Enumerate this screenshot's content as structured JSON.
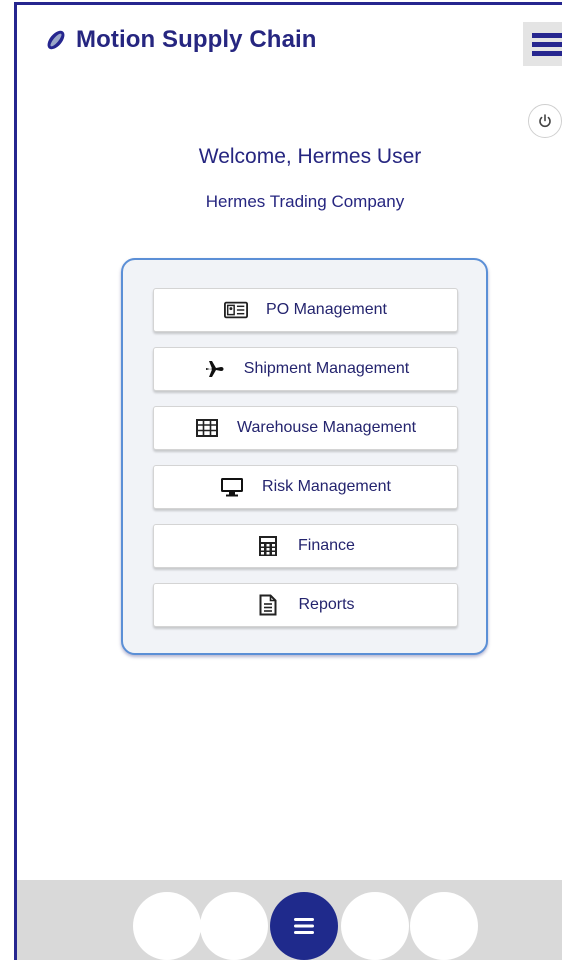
{
  "header": {
    "app_title": "Motion Supply Chain",
    "logo_icon": "leaf-logo-icon",
    "menu_icon": "hamburger-menu-icon",
    "power_icon": "power-icon"
  },
  "user": {
    "welcome": "Welcome, Hermes User",
    "company": "Hermes Trading Company"
  },
  "menu": {
    "items": [
      {
        "label": "PO Management",
        "icon": "id-card-icon"
      },
      {
        "label": "Shipment Management",
        "icon": "airplane-icon"
      },
      {
        "label": "Warehouse Management",
        "icon": "table-grid-icon"
      },
      {
        "label": "Risk Management",
        "icon": "monitor-icon"
      },
      {
        "label": "Finance",
        "icon": "calculator-icon"
      },
      {
        "label": "Reports",
        "icon": "document-icon"
      }
    ]
  },
  "bottom_nav": {
    "active_index": 2,
    "active_icon": "hamburger-menu-icon"
  },
  "colors": {
    "brand": "#26268f",
    "card_border": "#5b8fd6",
    "text": "#262680",
    "bottom_bar": "#d9d9d9"
  }
}
